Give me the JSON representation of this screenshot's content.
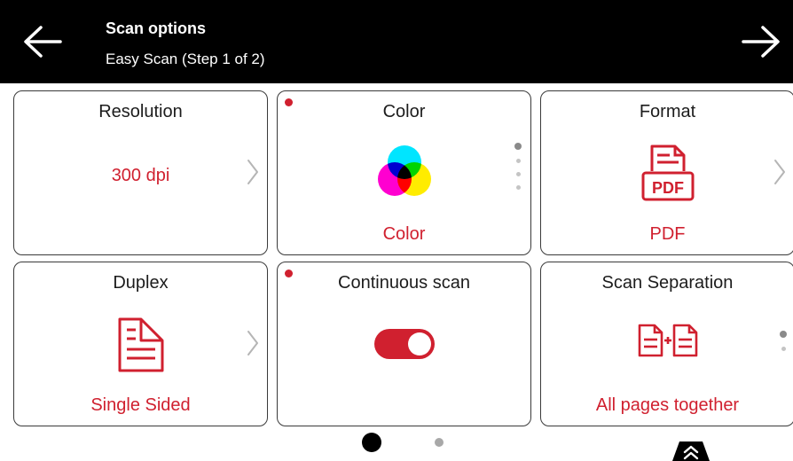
{
  "header": {
    "title": "Scan options",
    "subtitle": "Easy Scan (Step 1 of 2)",
    "back_icon": "arrow-left-icon",
    "next_icon": "arrow-right-icon"
  },
  "tiles": [
    {
      "label": "Resolution",
      "value": "300 dpi",
      "icon": "none",
      "has_chevron": true
    },
    {
      "label": "Color",
      "value": "Color",
      "icon": "color-circles-icon",
      "has_red_dot": true,
      "page_indicator": {
        "total": 4,
        "active": 1
      }
    },
    {
      "label": "Format",
      "value": "PDF",
      "icon": "pdf-document-icon",
      "icon_text": "PDF",
      "has_chevron": true
    },
    {
      "label": "Duplex",
      "value": "Single Sided",
      "icon": "single-sided-document-icon",
      "has_chevron": true
    },
    {
      "label": "Continuous scan",
      "value": "On",
      "icon": "toggle-switch",
      "has_red_dot": true
    },
    {
      "label": "Scan Separation",
      "value": "All pages together",
      "icon": "documents-merge-icon",
      "page_indicator": {
        "total": 2,
        "active": 1
      }
    }
  ],
  "pagination": {
    "total": 2,
    "active": 1
  },
  "collapse_icon": "double-chevron-up-icon",
  "colors": {
    "accent": "#d0202f",
    "header_bg": "#000000",
    "border": "#3a3a3a"
  }
}
